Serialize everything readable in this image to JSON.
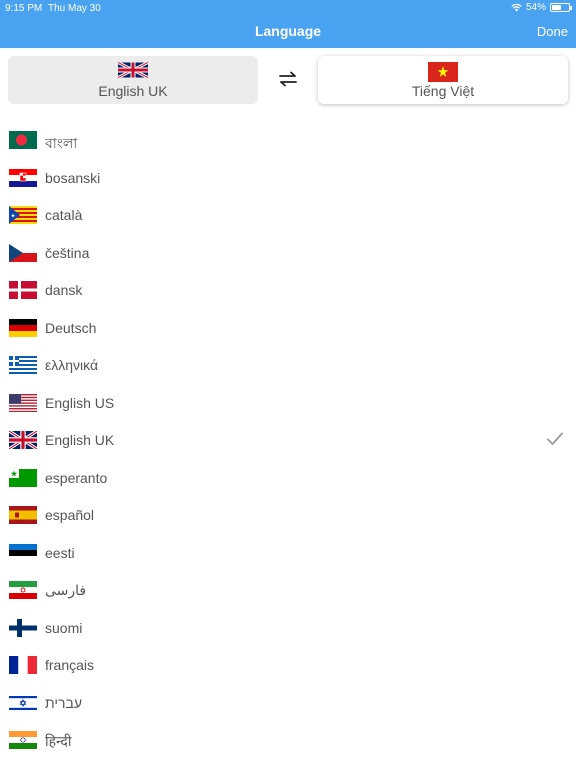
{
  "status": {
    "time": "9:15 PM",
    "date": "Thu May 30",
    "battery": "54%",
    "battery_level": 0.54
  },
  "nav": {
    "title": "Language",
    "done_label": "Done"
  },
  "source": {
    "label": "English UK",
    "flag_icon": "uk-flag-icon"
  },
  "target": {
    "label": "Tiếng Việt",
    "flag_icon": "vietnam-flag-icon"
  },
  "swap_icon": "swap-arrows-icon",
  "selected_language": "English UK",
  "languages": [
    {
      "label": "বাংলা",
      "flag": "bd"
    },
    {
      "label": "bosanski",
      "flag": "hr"
    },
    {
      "label": "català",
      "flag": "cat"
    },
    {
      "label": "čeština",
      "flag": "cz"
    },
    {
      "label": "dansk",
      "flag": "dk"
    },
    {
      "label": "Deutsch",
      "flag": "de"
    },
    {
      "label": "ελληνικά",
      "flag": "gr"
    },
    {
      "label": "English US",
      "flag": "us"
    },
    {
      "label": "English UK",
      "flag": "uk"
    },
    {
      "label": "esperanto",
      "flag": "eo"
    },
    {
      "label": "español",
      "flag": "es"
    },
    {
      "label": "eesti",
      "flag": "ee"
    },
    {
      "label": "فارسی",
      "flag": "ir"
    },
    {
      "label": "suomi",
      "flag": "fi"
    },
    {
      "label": "français",
      "flag": "fr"
    },
    {
      "label": "עברית",
      "flag": "il"
    },
    {
      "label": "हिन्दी",
      "flag": "in"
    }
  ],
  "colors": {
    "accent": "#4aa3f0",
    "text": "#555555",
    "check": "#9a9a9a"
  }
}
